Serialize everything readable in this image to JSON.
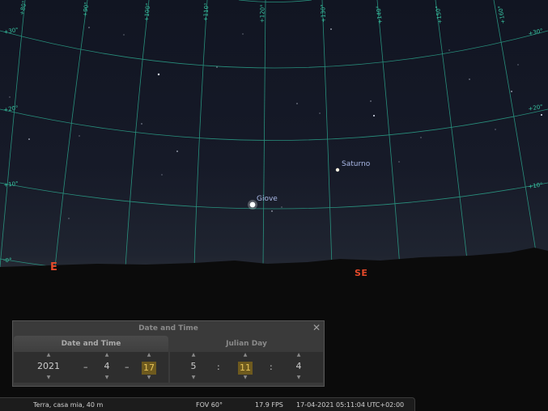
{
  "sky": {
    "grid_labels": [
      "+30°",
      "+20°",
      "+10°",
      "-0°",
      "+90°",
      "+100°",
      "+110°",
      "+120°",
      "+130°",
      "+140°",
      "+150°",
      "+160°",
      "+30°",
      "+20°",
      "+10°",
      "+80°"
    ],
    "planets": [
      {
        "name": "Saturno"
      },
      {
        "name": "Giove"
      }
    ],
    "cardinals": {
      "east": "E",
      "southeast": "SE"
    },
    "colors": {
      "grid": "#2fb89a",
      "cardinal": "#e44a2a",
      "planet_label": "#a9b8e6"
    }
  },
  "dialog": {
    "title": "Date and Time",
    "close_icon": "close-icon",
    "tabs": {
      "date_time": "Date and Time",
      "julian_day": "Julian Day"
    },
    "date": {
      "year": "2021",
      "month": "4",
      "day": "17",
      "sep1": "–",
      "sep2": "–"
    },
    "time": {
      "hour": "5",
      "minute": "11",
      "second": "4",
      "sep1": ":",
      "sep2": ":"
    }
  },
  "status": {
    "location": "Terra, casa mia, 40 m",
    "fov": "FOV 60°",
    "fps": "17.9 FPS",
    "datetime": "17-04-2021 05:11:04 UTC+02:00"
  }
}
